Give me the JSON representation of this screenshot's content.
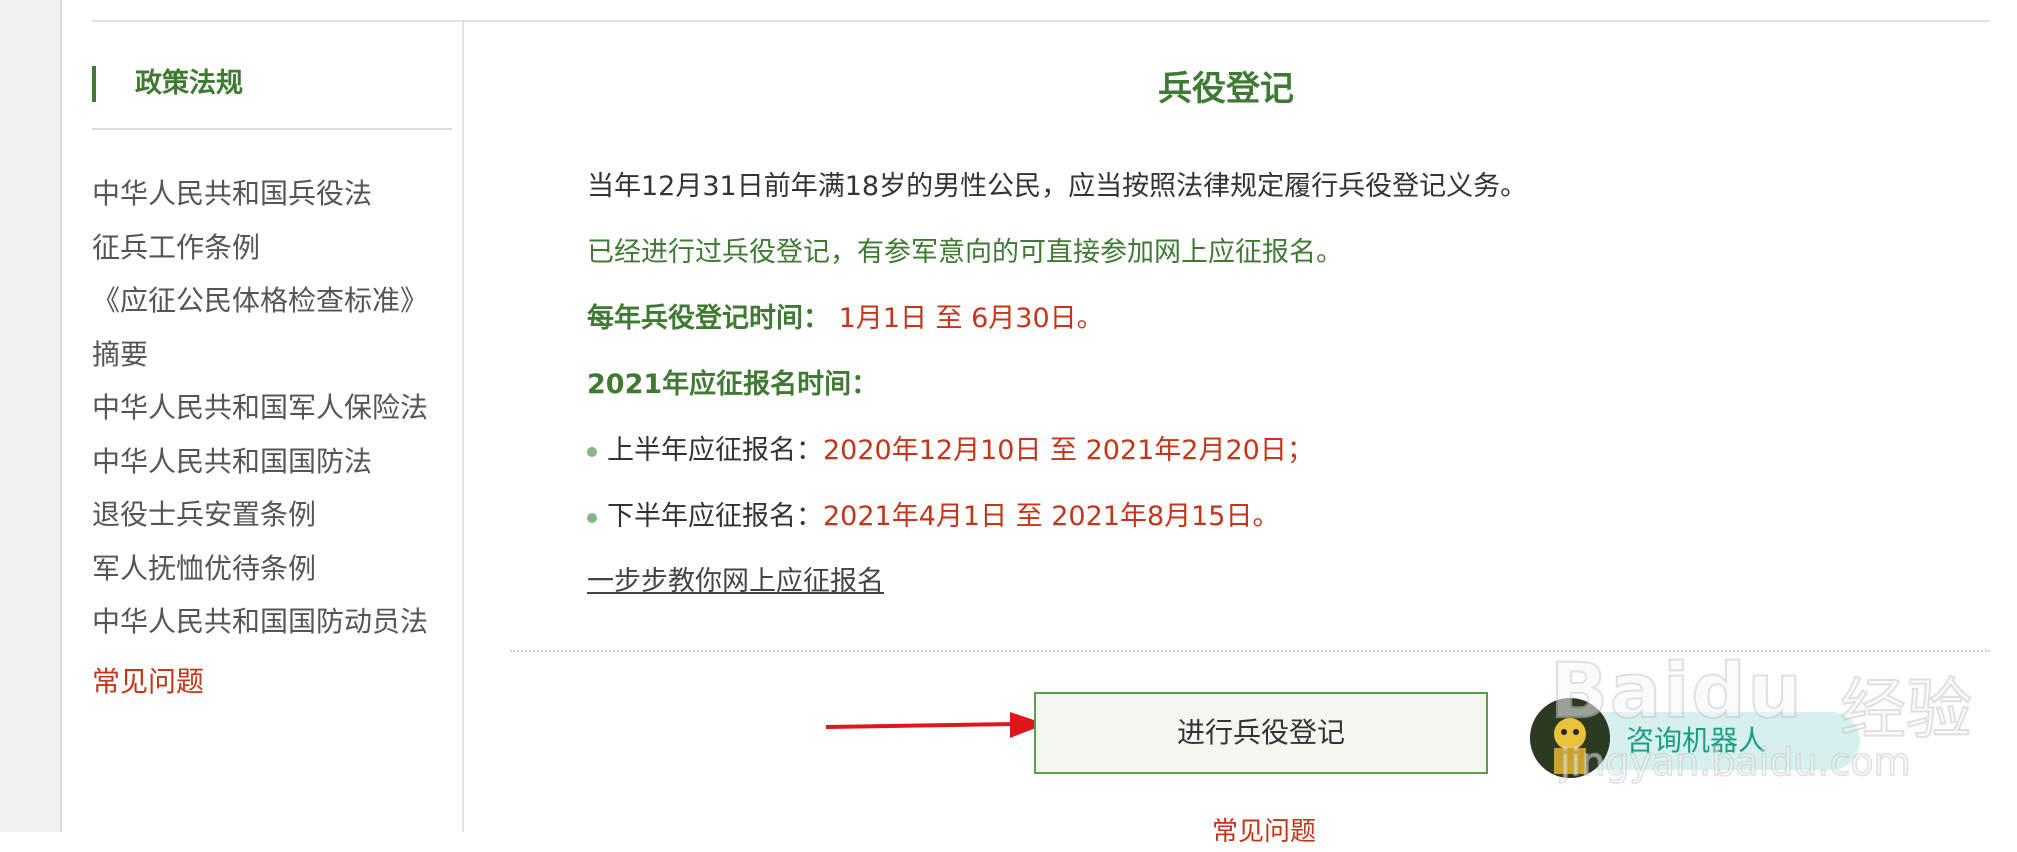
{
  "sidebar": {
    "title": "政策法规",
    "items": [
      "中华人民共和国兵役法",
      "征兵工作条例",
      "《应征公民体格检查标准》",
      "摘要",
      "中华人民共和国军人保险法",
      "中华人民共和国国防法",
      "退役士兵安置条例",
      "军人抚恤优待条例",
      "中华人民共和国国防动员法"
    ],
    "faq": "常见问题"
  },
  "main": {
    "title": "兵役登记",
    "p1": "当年12月31日前年满18岁的男性公民，应当按照法律规定履行兵役登记义务。",
    "p2": "已经进行过兵役登记，有参军意向的可直接参加网上应征报名。",
    "reg_time_label": "每年兵役登记时间：",
    "reg_time_value": "1月1日 至 6月30日。",
    "enlist_heading": "2021年应征报名时间：",
    "first_half_label": "上半年应征报名：",
    "first_half_value": "2020年12月10日 至 2021年2月20日；",
    "second_half_label": "下半年应征报名：",
    "second_half_value": "2021年4月1日 至 2021年8月15日。",
    "guide_link": "一步步教你网上应征报名",
    "register_button": "进行兵役登记",
    "robot_label": "咨询机器人",
    "bottom_faq": "常见问题"
  },
  "watermark": {
    "brand": "Baidu",
    "brand_cn": "经验",
    "url": "jingyan.baidu.com"
  },
  "colors": {
    "accent_green": "#3f7a33",
    "alert_red": "#c4351a",
    "arrow_red": "#e0161d"
  },
  "icons": [
    "avatar-robot-icon",
    "bullet-dot-icon",
    "arrow-annotation"
  ]
}
